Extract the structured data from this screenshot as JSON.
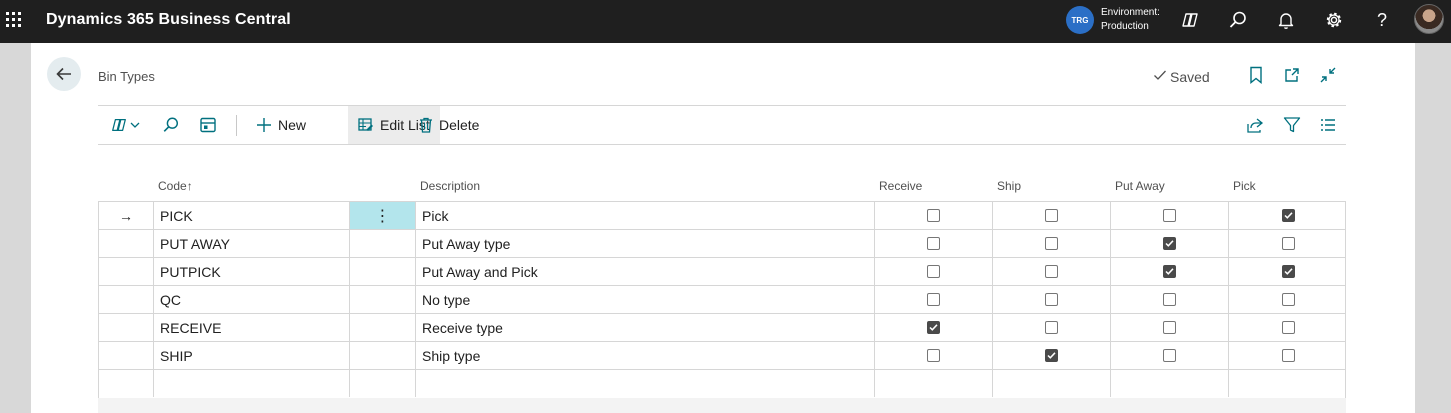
{
  "app": {
    "title": "Dynamics 365 Business Central",
    "env_badge": "TRG",
    "env_label": "Environment:",
    "env_value": "Production"
  },
  "page": {
    "title": "Bin Types",
    "saved_label": "Saved"
  },
  "actions": {
    "new_label": "New",
    "edit_list_label": "Edit List",
    "delete_label": "Delete"
  },
  "columns": {
    "code": "Code",
    "sort_indicator": "↑",
    "description": "Description",
    "receive": "Receive",
    "ship": "Ship",
    "put_away": "Put Away",
    "pick": "Pick"
  },
  "rows": [
    {
      "code": "PICK",
      "description": "Pick",
      "receive": false,
      "ship": false,
      "put_away": false,
      "pick": true,
      "selected": true
    },
    {
      "code": "PUT AWAY",
      "description": "Put Away type",
      "receive": false,
      "ship": false,
      "put_away": true,
      "pick": false,
      "selected": false
    },
    {
      "code": "PUTPICK",
      "description": "Put Away and Pick",
      "receive": false,
      "ship": false,
      "put_away": true,
      "pick": true,
      "selected": false
    },
    {
      "code": "QC",
      "description": "No type",
      "receive": false,
      "ship": false,
      "put_away": false,
      "pick": false,
      "selected": false
    },
    {
      "code": "RECEIVE",
      "description": "Receive type",
      "receive": true,
      "ship": false,
      "put_away": false,
      "pick": false,
      "selected": false
    },
    {
      "code": "SHIP",
      "description": "Ship type",
      "receive": false,
      "ship": true,
      "put_away": false,
      "pick": false,
      "selected": false
    }
  ],
  "icons": {
    "row_arrow": "→",
    "row_menu": "⋮"
  },
  "colors": {
    "appbar": "#1f1f1f",
    "accent": "#2b6fc6",
    "teal": "#00707f",
    "selected_cell": "#b3e5ec"
  }
}
